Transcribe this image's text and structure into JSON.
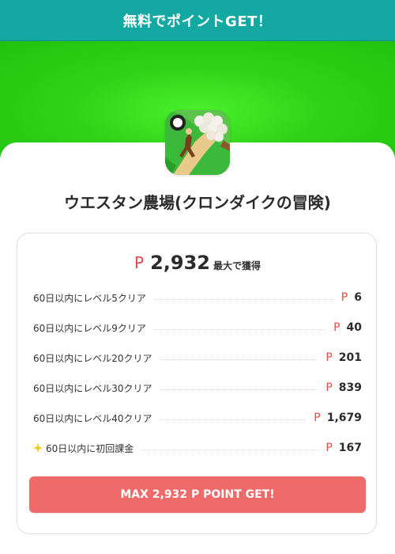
{
  "header": {
    "title": "無料でポイントGET！"
  },
  "app": {
    "icon": "farm-game-app-icon",
    "name": "ウエスタン農場(クロンダイクの冒険)"
  },
  "offer": {
    "currency_symbol": "P",
    "total_points": "2,932",
    "total_suffix": "最大で獲得",
    "rows": [
      {
        "label": "60日以内にレベル5クリア",
        "points": "6"
      },
      {
        "label": "60日以内にレベル9クリア",
        "points": "40"
      },
      {
        "label": "60日以内にレベル20クリア",
        "points": "201"
      },
      {
        "label": "60日以内にレベル30クリア",
        "points": "839"
      },
      {
        "label": "60日以内にレベル40クリア",
        "points": "1,679"
      },
      {
        "label": "60日以内に初回課金",
        "points": "167",
        "icon": "sparkle-icon"
      }
    ]
  },
  "cta": {
    "label": "MAX 2,932 P POINT GET!"
  },
  "colors": {
    "header": "#14a8a2",
    "banner_green": "#2fd316",
    "accent_red": "#e84848",
    "cta": "#ef6b69",
    "sparkle": "#f5c200"
  }
}
